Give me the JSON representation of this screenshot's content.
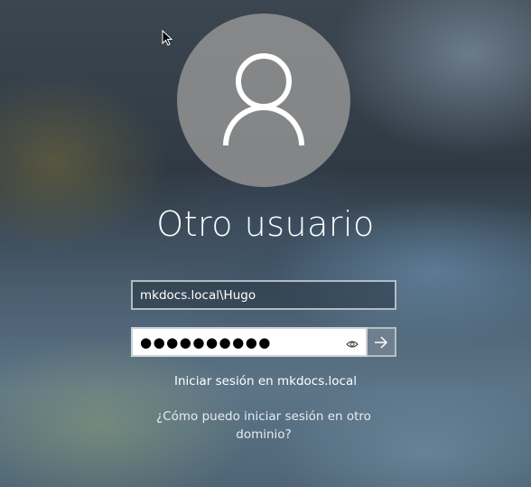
{
  "login": {
    "user_display_name": "Otro usuario",
    "username_value": "mkdocs.local\\Hugo",
    "password_masked": "●●●●●●●●●●",
    "sign_in_to_label": "Iniciar sesión en mkdocs.local",
    "other_domain_link": "¿Cómo puedo iniciar sesión en otro dominio?"
  },
  "icons": {
    "avatar": "user-silhouette-icon",
    "reveal": "eye-icon",
    "submit": "arrow-right-icon",
    "cursor": "mouse-pointer-icon"
  }
}
